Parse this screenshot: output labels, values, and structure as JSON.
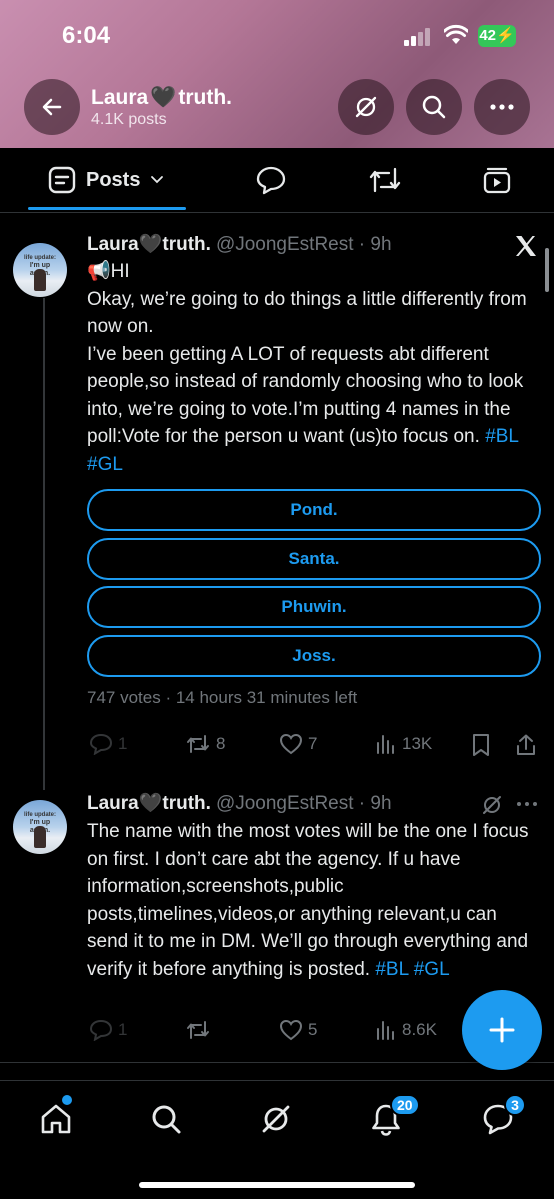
{
  "status_bar": {
    "time": "6:04",
    "battery": "42"
  },
  "header": {
    "name_part1": "Laura",
    "heart": "🖤",
    "name_part2": "truth.",
    "post_count": "4.1K posts"
  },
  "tabs": {
    "posts_label": "Posts"
  },
  "post1": {
    "name": "Laura🖤truth.",
    "handle": "@JoongEstRest",
    "time": "9h",
    "avatar_caption_1": "life update:",
    "avatar_caption_2": "I'm up again.",
    "line1": "📢HI",
    "line2": "Okay, we’re going to do things a little differently from now on.",
    "line3": "I’ve been getting A LOT of requests abt different people,so instead of randomly choosing who to look into, we’re going to vote.I’m putting 4 names in the poll:Vote for the person u want (us)to focus on.",
    "tag1": "#BL",
    "tag2": "#GL",
    "poll_options": [
      "Pond.",
      "Santa.",
      "Phuwin.",
      "Joss."
    ],
    "poll_meta": "747 votes · 14 hours 31 minutes left",
    "replies": "1",
    "reposts": "8",
    "likes": "7",
    "views": "13K"
  },
  "post2": {
    "name": "Laura🖤truth.",
    "handle": "@JoongEstRest",
    "time": "9h",
    "avatar_caption_1": "life update:",
    "avatar_caption_2": "I'm up again.",
    "text": "The name with the most votes will be the one I focus on first. I don’t care abt the agency. If u have information,screenshots,public posts,timelines,videos,or anything relevant,u can send it to me in DM. We’ll go through everything and verify it before anything is posted.",
    "tag1": "#BL",
    "tag2": "#GL",
    "replies": "1",
    "likes": "5",
    "views": "8.6K"
  },
  "bottom_nav": {
    "notifications_badge": "20",
    "messages_badge": "3"
  },
  "colors": {
    "accent": "#1d9bf0",
    "background": "#000000",
    "muted": "#71767b"
  },
  "icons": [
    "back-arrow-icon",
    "grok-icon",
    "search-icon",
    "more-icon",
    "posts-icon",
    "chevron-down-icon",
    "replies-tab-icon",
    "reposts-tab-icon",
    "media-tab-icon",
    "x-logo-icon",
    "reply-icon",
    "repost-icon",
    "like-icon",
    "views-icon",
    "bookmark-icon",
    "share-icon",
    "compose-icon",
    "home-icon",
    "explore-icon",
    "grok-nav-icon",
    "notifications-icon",
    "messages-icon"
  ]
}
